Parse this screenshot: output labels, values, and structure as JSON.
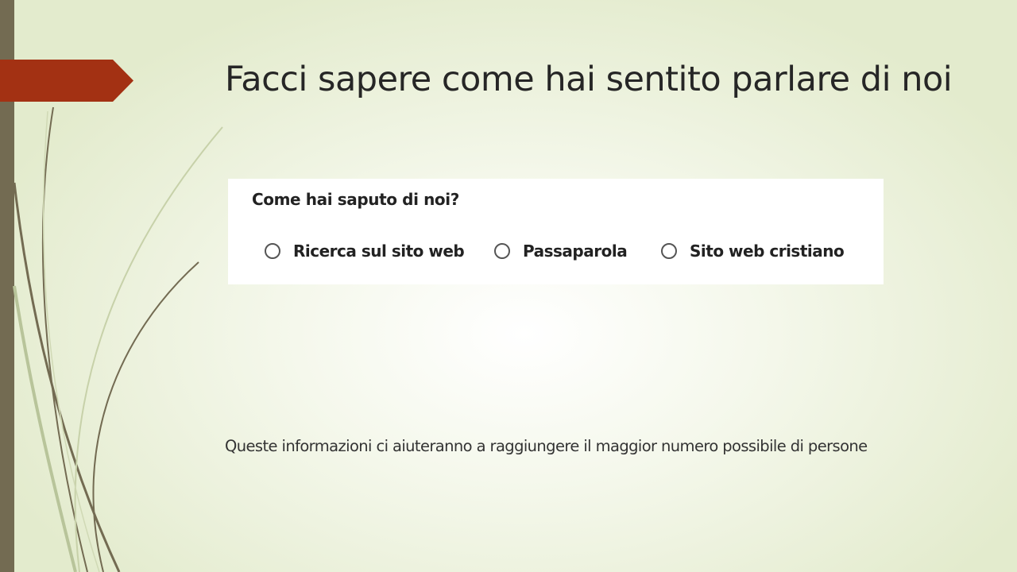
{
  "slide": {
    "title": "Facci sapere come hai sentito parlare di noi",
    "subtitle": "Queste informazioni ci aiuteranno a raggiungere il maggior numero possibile di persone",
    "colors": {
      "accent_arrow": "#a33113",
      "left_bar": "#736b52",
      "background": "#e3ebcd",
      "stems": "#736b52"
    }
  },
  "form": {
    "question": "Come hai saputo di noi?",
    "options": [
      {
        "label": "Ricerca sul sito web",
        "selected": false
      },
      {
        "label": "Passaparola",
        "selected": false
      },
      {
        "label": "Sito web cristiano",
        "selected": false
      }
    ]
  }
}
